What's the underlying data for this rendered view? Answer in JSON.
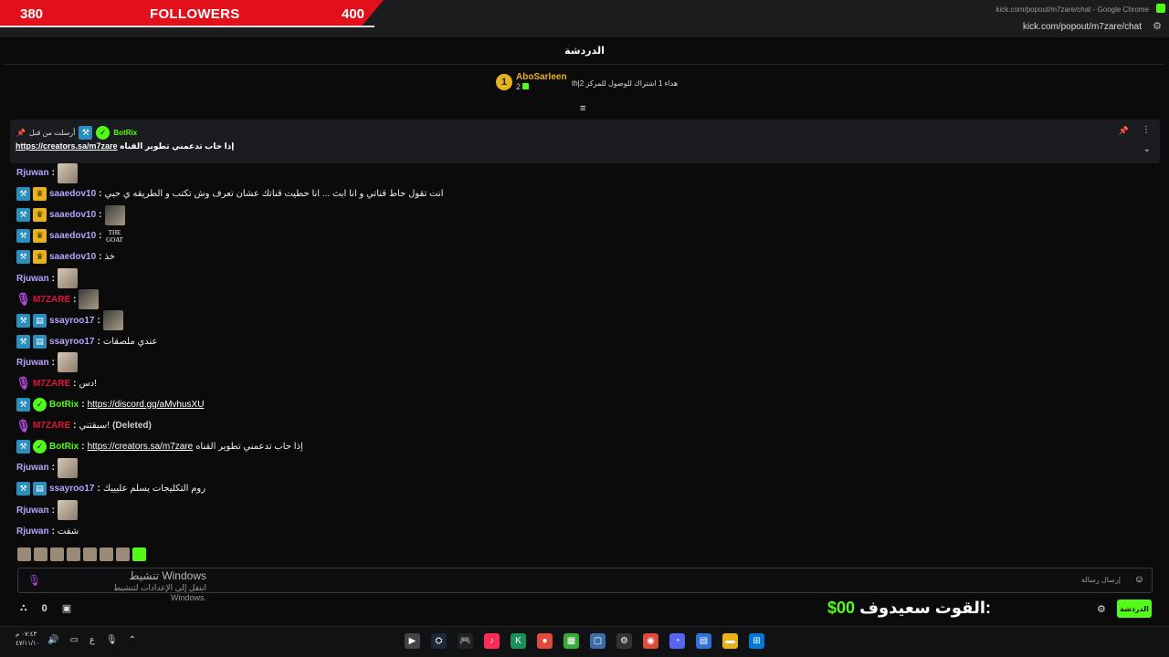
{
  "overlay": {
    "current": "380",
    "label": "FOLLOWERS",
    "goal": "400"
  },
  "window": {
    "title": "kick.com/popout/m7zare/chat - Google Chrome",
    "address": "kick.com/popout/m7zare/chat"
  },
  "chat": {
    "title": "الدردشة"
  },
  "top_gifter": {
    "rank": "1",
    "name": "AboSarleen",
    "count": "2",
    "message": "th|هداء 1 اشتراك للوصول للمركز 2"
  },
  "pinned": {
    "by": "أرسلت من قبل",
    "user": "BotRix",
    "link": "https://creators.sa/m7zare",
    "text": "إذا حاب تدعمني تطوير القناه"
  },
  "messages": [
    {
      "user": "Rjuwan",
      "color": "#b9a4ff",
      "badges": [],
      "text": "",
      "emote": "photo"
    },
    {
      "user": "saaedov10",
      "color": "#b9a4ff",
      "badges": [
        "mod",
        "vip"
      ],
      "text": "انت تقول حاط قناتي و انا ابث ... انا حطيت قناتك عشان تعرف وش تكتب و الطريقه ي حبي"
    },
    {
      "user": "saaedov10",
      "color": "#b9a4ff",
      "badges": [
        "mod",
        "vip"
      ],
      "text": "",
      "emote": "dark"
    },
    {
      "user": "saaedov10",
      "color": "#b9a4ff",
      "badges": [
        "mod",
        "vip"
      ],
      "text": "",
      "emote": "goat"
    },
    {
      "user": "saaedov10",
      "color": "#b9a4ff",
      "badges": [
        "mod",
        "vip"
      ],
      "text": "خذ"
    },
    {
      "user": "Rjuwan",
      "color": "#b9a4ff",
      "badges": [],
      "text": "",
      "emote": "photo"
    },
    {
      "user": "M7ZARE",
      "color": "#e0123c",
      "badges": [
        "host"
      ],
      "text": "",
      "emote": "dark"
    },
    {
      "user": "ssayroo17",
      "color": "#b9a4ff",
      "badges": [
        "mod",
        "sub"
      ],
      "text": "",
      "emote": "dark"
    },
    {
      "user": "ssayroo17",
      "color": "#b9a4ff",
      "badges": [
        "mod",
        "sub"
      ],
      "text": "عندي ملصقات"
    },
    {
      "user": "Rjuwan",
      "color": "#b9a4ff",
      "badges": [],
      "text": "",
      "emote": "photo"
    },
    {
      "user": "M7ZARE",
      "color": "#e0123c",
      "badges": [
        "host"
      ],
      "text": "دس!"
    },
    {
      "user": "BotRix",
      "color": "#53fc18",
      "badges": [
        "mod",
        "ver"
      ],
      "text": "",
      "link": "https://discord.gg/aMvhusXU"
    },
    {
      "user": "M7ZARE",
      "color": "#e0123c",
      "badges": [
        "host"
      ],
      "text": "سبقتني!",
      "deleted": "(Deleted)"
    },
    {
      "user": "BotRix",
      "color": "#53fc18",
      "badges": [
        "mod",
        "ver"
      ],
      "text": "إذا حاب تدعمني تطوير القناه",
      "link": "https://creators.sa/m7zare"
    },
    {
      "user": "Rjuwan",
      "color": "#b9a4ff",
      "badges": [],
      "text": "",
      "emote": "photo"
    },
    {
      "user": "ssayroo17",
      "color": "#b9a4ff",
      "badges": [
        "mod",
        "sub"
      ],
      "text": "روم التكليجات يسلم عليييك"
    },
    {
      "user": "Rjuwan",
      "color": "#b9a4ff",
      "badges": [],
      "text": "",
      "emote": "photo"
    },
    {
      "user": "Rjuwan",
      "color": "#b9a4ff",
      "badges": [],
      "text": "شفت"
    }
  ],
  "input": {
    "placeholder": "إرسال رسالة"
  },
  "watermark": {
    "line1": "تنشيط Windows",
    "line2": "انتقل إلى الإعدادات لتنشيط Windows."
  },
  "footer": {
    "viewers": "0",
    "points_label": "القوت سعيدوف:",
    "points_amount": "$00",
    "chat_button": "الدردشة"
  },
  "taskbar": {
    "time": "٠٧:٤٣ م",
    "date": "٤٧/١١/١٠",
    "lang": "ع"
  }
}
